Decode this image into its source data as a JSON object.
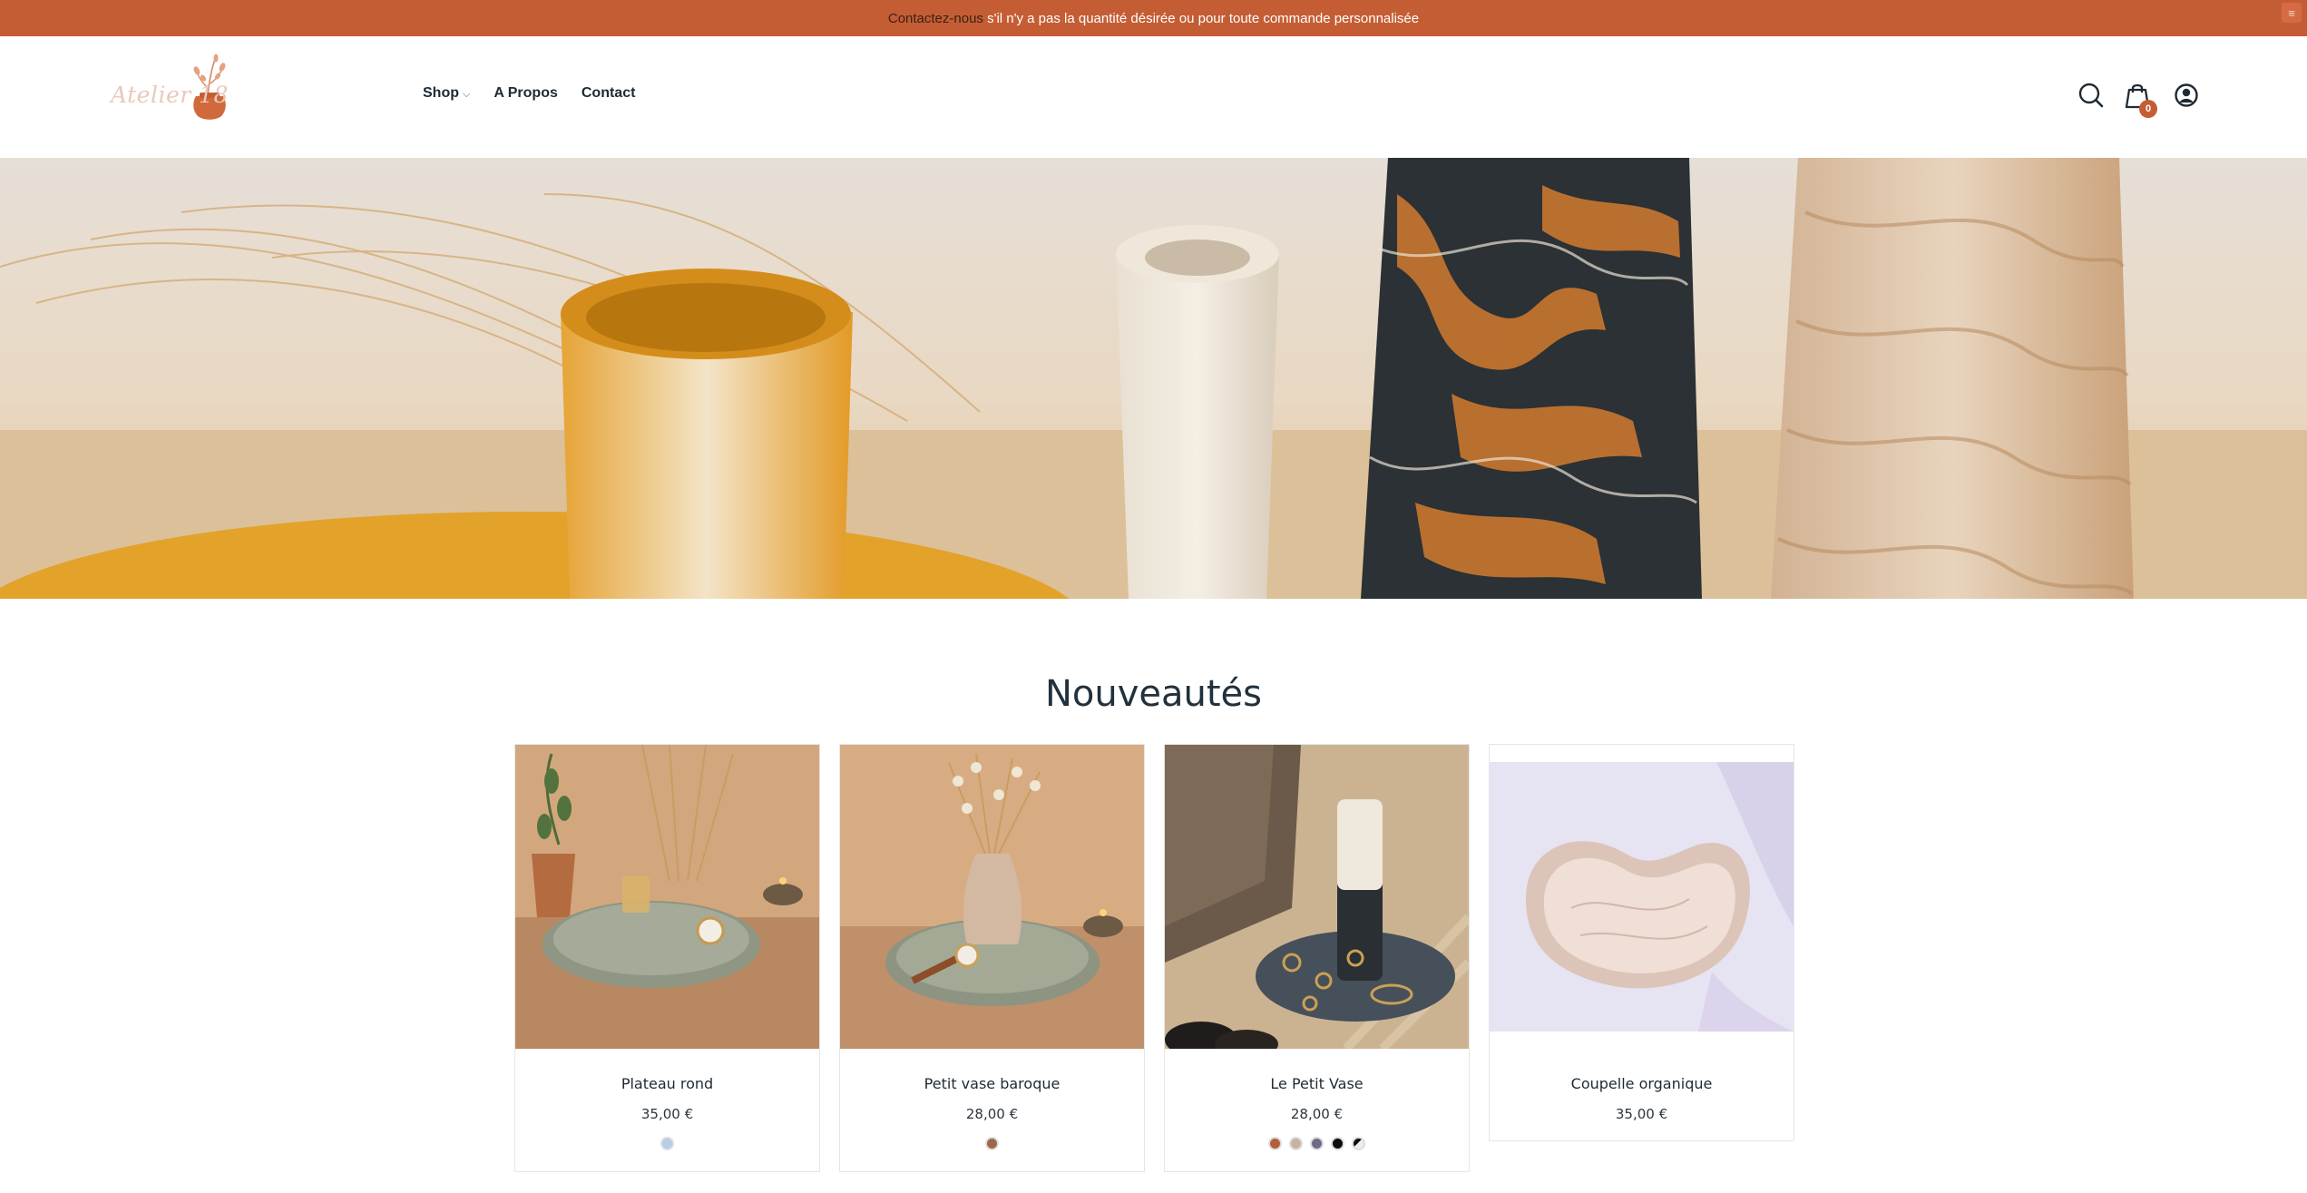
{
  "announcement": {
    "link_text": "Contactez-nous",
    "text": " s'il n'y a pas la quantité désirée ou pour toute commande personnalisée",
    "menu_icon": "hamburger-icon"
  },
  "header": {
    "logo_text": "Atelier 18",
    "nav": [
      {
        "label": "Shop",
        "has_dropdown": true
      },
      {
        "label": "A Propos"
      },
      {
        "label": "Contact"
      }
    ],
    "cart_count": "0",
    "icons": [
      "search-icon",
      "cart-icon",
      "account-icon"
    ]
  },
  "section": {
    "title": "Nouveautés"
  },
  "products": [
    {
      "name": "Plateau rond",
      "price": "35,00 €",
      "swatches": [
        "#b7cce6"
      ]
    },
    {
      "name": "Petit vase baroque",
      "price": "28,00 €",
      "swatches": [
        "#a0654a"
      ]
    },
    {
      "name": "Le Petit Vase",
      "price": "28,00 €",
      "swatches": [
        "#b0603a",
        "#c9b1a2",
        "#6f6a86",
        "#0d0d0d",
        "#e9eef2"
      ]
    },
    {
      "name": "Coupelle organique",
      "price": "35,00 €",
      "swatches": []
    }
  ],
  "colors": {
    "accent": "#c55d34",
    "text": "#1f2a33"
  }
}
